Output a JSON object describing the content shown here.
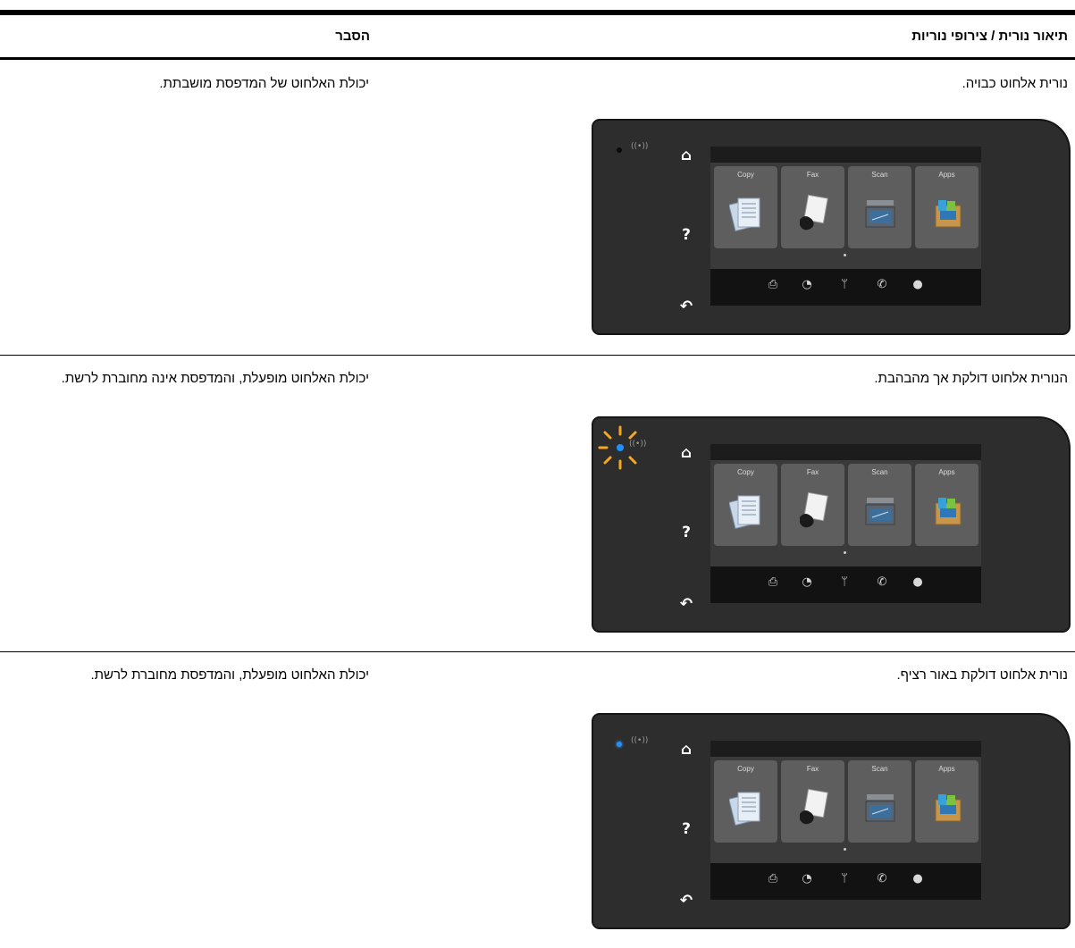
{
  "table": {
    "headers": {
      "description": "תיאור נורית / צירופי נוריות",
      "explanation": "הסבר"
    },
    "rows": [
      {
        "description": "נורית אלחוט כבויה.",
        "explanation": "יכולת האלחוט של המדפסת מושבתת.",
        "wireless_light": "off"
      },
      {
        "description": "הנורית אלחוט דולקת אך מהבהבת.",
        "explanation": "יכולת האלחוט מופעלת, והמדפסת אינה מחוברת לרשת.",
        "wireless_light": "blinking"
      },
      {
        "description": "נורית אלחוט דולקת באור רציף.",
        "explanation": "יכולת האלחוט מופעלת, והמדפסת מחוברת לרשת.",
        "wireless_light": "on"
      }
    ]
  },
  "panel": {
    "tiles": [
      "Copy",
      "Fax",
      "Scan",
      "Apps"
    ],
    "wireless_symbol": "((•))",
    "side_icons": [
      "home-icon",
      "help-icon",
      "back-icon"
    ],
    "bottom_icons": [
      "hp-eprint-icon",
      "web-services-icon",
      "wireless-icon",
      "phone-icon",
      "ink-drop-icon"
    ]
  },
  "colors": {
    "panel_bg": "#2d2d2d",
    "led_blue": "#1e90ff",
    "blink_orange": "#f5a623"
  }
}
